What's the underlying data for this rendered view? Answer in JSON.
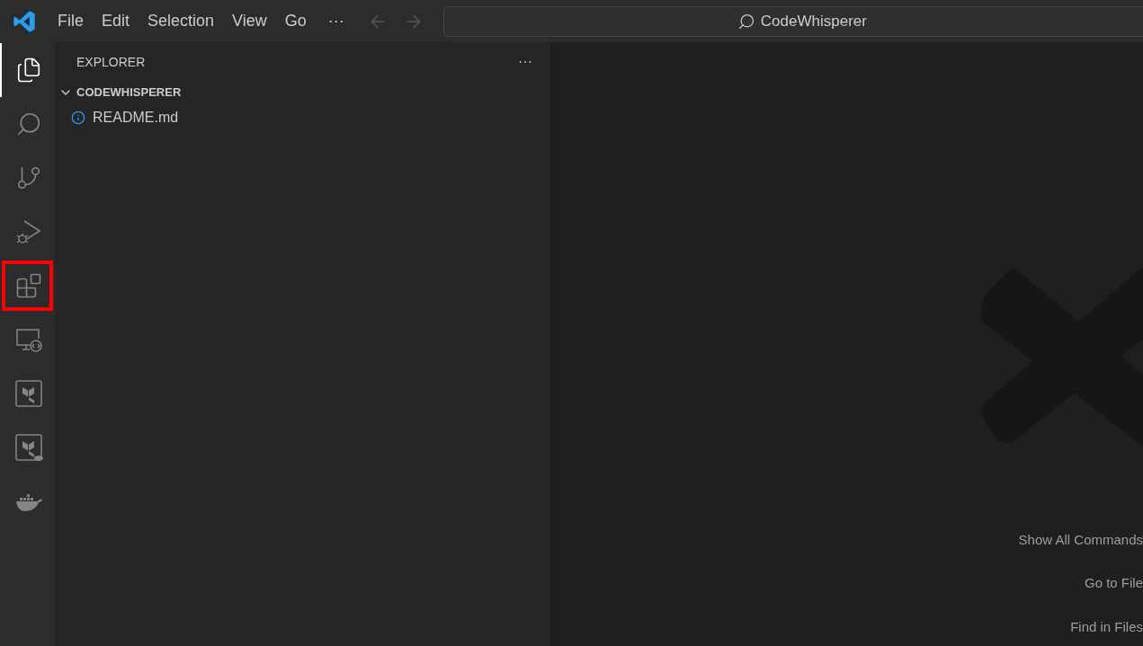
{
  "menu_bar": {
    "items": [
      "File",
      "Edit",
      "Selection",
      "View",
      "Go"
    ],
    "more": "···"
  },
  "command_center": {
    "text": "CodeWhisperer"
  },
  "activity_bar": {
    "items": [
      {
        "kind": "explorer",
        "selected": true,
        "highlighted": false
      },
      {
        "kind": "search",
        "selected": false,
        "highlighted": false
      },
      {
        "kind": "source-control",
        "selected": false,
        "highlighted": false
      },
      {
        "kind": "run-debug",
        "selected": false,
        "highlighted": false
      },
      {
        "kind": "extensions",
        "selected": false,
        "highlighted": true
      },
      {
        "kind": "remote",
        "selected": false,
        "highlighted": false
      },
      {
        "kind": "terraform",
        "selected": false,
        "highlighted": false
      },
      {
        "kind": "terraform-cloud",
        "selected": false,
        "highlighted": false
      },
      {
        "kind": "docker",
        "selected": false,
        "highlighted": false
      }
    ]
  },
  "sidebar": {
    "title": "EXPLORER",
    "more": "···",
    "folder": {
      "name": "CODEWHISPERER",
      "expanded": true,
      "children": [
        {
          "name": "README.md"
        }
      ]
    }
  },
  "editor": {
    "shortcuts": [
      "Show All Commands",
      "Go to File",
      "Find in Files"
    ]
  }
}
